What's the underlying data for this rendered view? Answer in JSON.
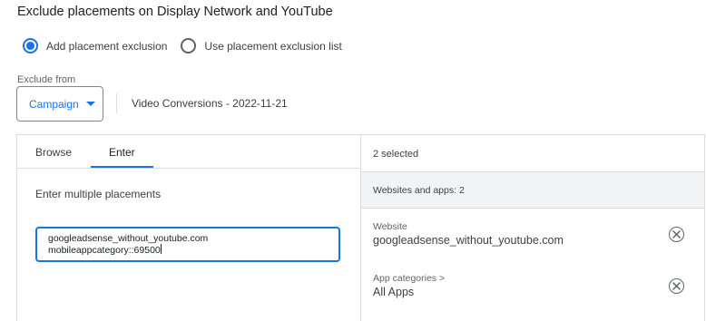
{
  "title": "Exclude placements on Display Network and YouTube",
  "options": {
    "add_exclusion": "Add placement exclusion",
    "use_list": "Use placement exclusion list"
  },
  "exclude_from": {
    "label": "Exclude from",
    "value": "Campaign",
    "campaign_name": "Video Conversions - 2022-11-21"
  },
  "tabs": {
    "browse": "Browse",
    "enter": "Enter"
  },
  "enter": {
    "heading": "Enter multiple placements",
    "line1": "googleadsense_without_youtube.com",
    "line2": "mobileappcategory::69500"
  },
  "selection": {
    "count_text": "2 selected",
    "group_header": "Websites and apps: 2",
    "items": [
      {
        "type_label": "Website",
        "value": "googleadsense_without_youtube.com"
      },
      {
        "type_label": "App categories >",
        "value": "All Apps"
      }
    ]
  },
  "colors": {
    "accent": "#1a73e8",
    "border": "#dadce0",
    "header_bg": "#f1f3f4"
  }
}
